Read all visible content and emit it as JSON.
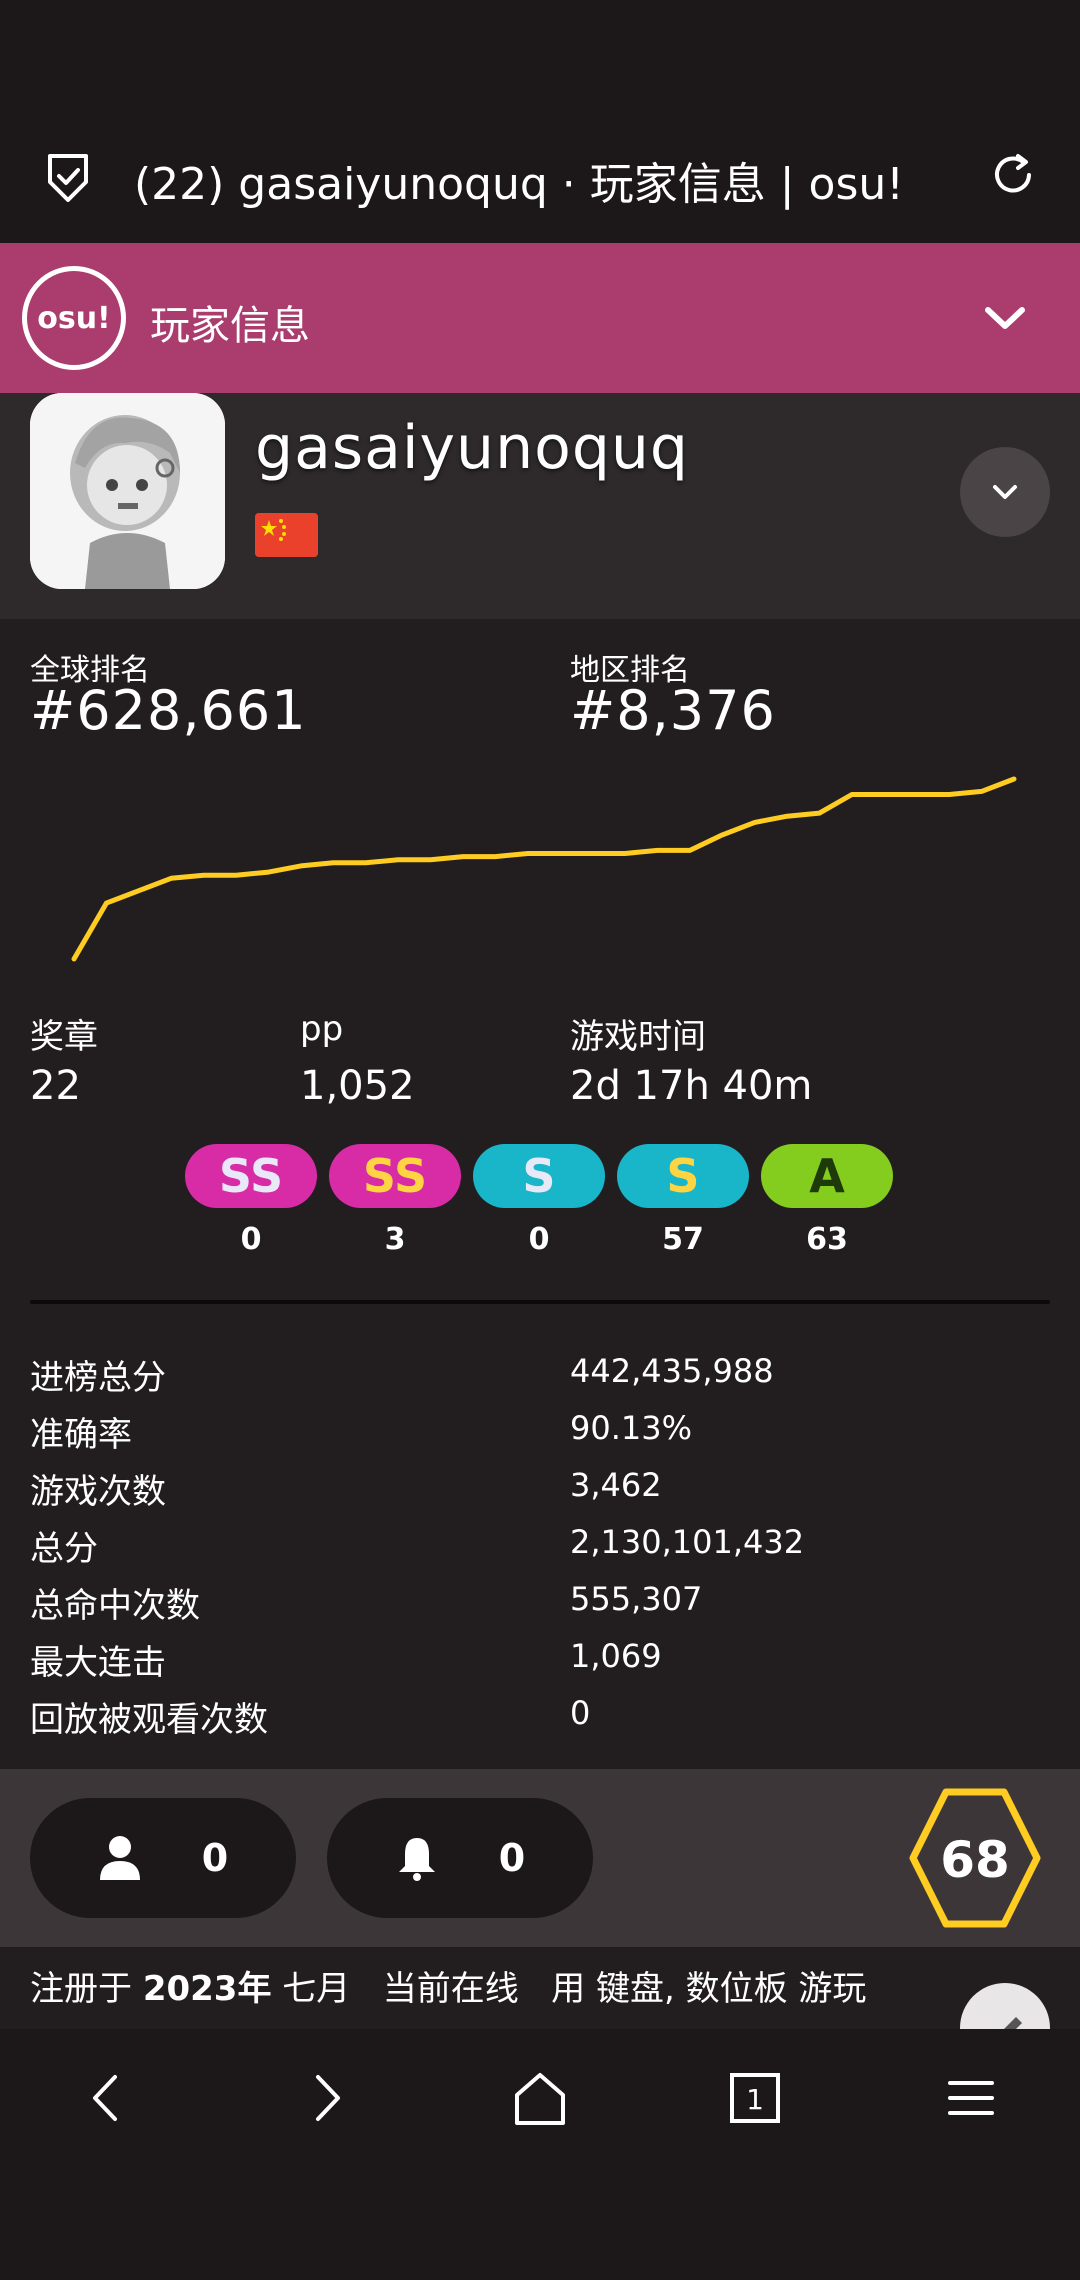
{
  "browser": {
    "tab_title": "(22) gasaiyunoquq · 玩家信息 | osu!"
  },
  "header": {
    "logo_text": "osu!",
    "section_title": "玩家信息"
  },
  "profile": {
    "username": "gasaiyunoquq",
    "country_flag": "china-flag"
  },
  "ranks": {
    "global_label": "全球排名",
    "global_value": "#628,661",
    "country_label": "地区排名",
    "country_value": "#8,376"
  },
  "rank_history": {
    "type": "line",
    "color": "#ffcc22",
    "values": [
      0,
      18,
      22,
      26,
      27,
      27,
      28,
      30,
      31,
      31,
      32,
      32,
      33,
      33,
      34,
      34,
      34,
      34,
      35,
      35,
      40,
      44,
      46,
      47,
      53,
      53,
      53,
      53,
      54,
      58
    ]
  },
  "summary": {
    "medals_label": "奖章",
    "medals_value": "22",
    "pp_label": "pp",
    "pp_value": "1,052",
    "playtime_label": "游戏时间",
    "playtime_value": "2d 17h 40m"
  },
  "grades": [
    {
      "name": "SSH",
      "letter": "SS",
      "count": "0",
      "bg": "#d82ba6",
      "fg": "#e8e8f8"
    },
    {
      "name": "SS",
      "letter": "SS",
      "count": "3",
      "bg": "#d82ba6",
      "fg": "#ffd443"
    },
    {
      "name": "SH",
      "letter": "S",
      "count": "0",
      "bg": "#19b6c9",
      "fg": "#e8e8f8"
    },
    {
      "name": "S",
      "letter": "S",
      "count": "57",
      "bg": "#19b6c9",
      "fg": "#ffd443"
    },
    {
      "name": "A",
      "letter": "A",
      "count": "63",
      "bg": "#84cc1e",
      "fg": "#1f3a0a"
    }
  ],
  "details": [
    {
      "label": "进榜总分",
      "value": "442,435,988"
    },
    {
      "label": "准确率",
      "value": "90.13%"
    },
    {
      "label": "游戏次数",
      "value": "3,462"
    },
    {
      "label": "总分",
      "value": "2,130,101,432"
    },
    {
      "label": "总命中次数",
      "value": "555,307"
    },
    {
      "label": "最大连击",
      "value": "1,069"
    },
    {
      "label": "回放被观看次数",
      "value": "0"
    }
  ],
  "social": {
    "friends_count": "0",
    "followers_count": "0",
    "level": "68",
    "level_color": "#ffcc22"
  },
  "joined": {
    "text_prefix": "注册于 ",
    "date": "2023年",
    "month": " 七月",
    "online": "当前在线",
    "plays_with": "用 键盘, 数位板 游玩"
  }
}
